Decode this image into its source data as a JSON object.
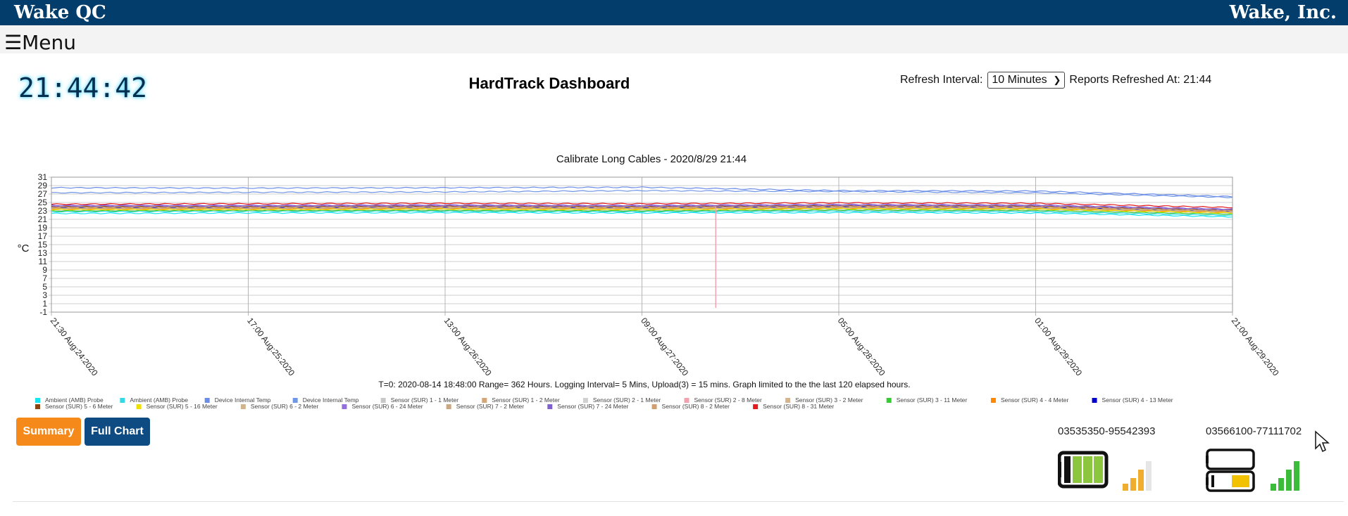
{
  "app": {
    "left_title": "Wake QC",
    "right_title": "Wake, Inc."
  },
  "menu": {
    "icon": "hamburger-icon",
    "label": "☰Menu"
  },
  "clock": "21:44:42",
  "dashboard_title": "HardTrack Dashboard",
  "refresh": {
    "label": "Refresh Interval:",
    "selected": "10 Minutes",
    "reports_text": "Reports Refreshed At: 21:44"
  },
  "chart_data": {
    "type": "line",
    "title": "Calibrate Long Cables - 2020/8/29 21:44",
    "ylabel": "°C",
    "xlabel": "",
    "ylim": [
      -1,
      31
    ],
    "yticks": [
      "31",
      "29",
      "27",
      "25",
      "23",
      "21",
      "19",
      "17",
      "15",
      "13",
      "11",
      "9",
      "7",
      "5",
      "3",
      "1",
      "-1"
    ],
    "x": [
      0,
      20,
      40,
      60,
      80,
      100,
      120
    ],
    "xlim": [
      0,
      120
    ],
    "xticks": [
      {
        "hours": 0,
        "label": "21:30 Aug:24:2020"
      },
      {
        "hours": 20,
        "label": "17:00 Aug:25:2020"
      },
      {
        "hours": 40,
        "label": "13:00 Aug:26:2020"
      },
      {
        "hours": 60,
        "label": "09:00 Aug:27:2020"
      },
      {
        "hours": 80,
        "label": "05:00 Aug:28:2020"
      },
      {
        "hours": 100,
        "label": "01:00 Aug:29:2020"
      },
      {
        "hours": 120,
        "label": "21:00 Aug:29:2020"
      }
    ],
    "footnote": "T=0: 2020-08-14 18:48:00 Range= 362 Hours. Logging Interval= 5 Mins, Upload(3) = 15 mins. Graph limited to the the last 120 elapsed hours.",
    "grid": true,
    "series": [
      {
        "name": "Ambient (AMB) Probe",
        "color": "#19e5f0",
        "values": [
          22.4,
          22.5,
          22.6,
          22.5,
          22.6,
          22.5,
          21.6
        ]
      },
      {
        "name": "Ambient (AMB) Probe",
        "color": "#35d8e6",
        "values": [
          22.8,
          22.9,
          22.9,
          22.8,
          22.9,
          22.8,
          21.9
        ]
      },
      {
        "name": "Device Internal Temp",
        "color": "#6b8de8",
        "values": [
          28.5,
          28.4,
          28.5,
          28.6,
          27.8,
          27.7,
          26.4
        ]
      },
      {
        "name": "Device Internal Temp",
        "color": "#7096e6",
        "values": [
          27.3,
          27.4,
          27.5,
          27.8,
          27.6,
          27.3,
          26.2
        ]
      },
      {
        "name": "Sensor (SUR) 1 - 1 Meter",
        "color": "#c8c8c8",
        "values": [
          23.4,
          23.4,
          23.5,
          23.4,
          23.6,
          23.5,
          22.6
        ]
      },
      {
        "name": "Sensor (SUR) 1 - 2 Meter",
        "color": "#d2a679",
        "values": [
          23.6,
          23.6,
          23.7,
          23.6,
          23.8,
          23.7,
          22.8
        ]
      },
      {
        "name": "Sensor (SUR) 2 - 1 Meter",
        "color": "#d0d0d0",
        "values": [
          23.2,
          23.2,
          23.3,
          23.2,
          23.4,
          23.3,
          22.4
        ]
      },
      {
        "name": "Sensor (SUR) 2 - 8 Meter",
        "color": "#f3a3b0",
        "values": [
          24.1,
          24.1,
          24.2,
          24.0,
          24.2,
          24.1,
          23.1
        ]
      },
      {
        "name": "Sensor (SUR) 3 - 2 Meter",
        "color": "#d8b48a",
        "values": [
          23.8,
          23.8,
          23.9,
          23.8,
          24.0,
          23.9,
          23.0
        ]
      },
      {
        "name": "Sensor (SUR) 3 - 11 Meter",
        "color": "#33cc33",
        "values": [
          23.0,
          23.1,
          23.1,
          23.0,
          23.2,
          23.1,
          22.2
        ]
      },
      {
        "name": "Sensor (SUR) 4 - 4 Meter",
        "color": "#ff8800",
        "values": [
          23.5,
          23.5,
          23.6,
          23.5,
          23.7,
          23.6,
          22.7
        ]
      },
      {
        "name": "Sensor (SUR) 4 - 13 Meter",
        "color": "#0000cc",
        "values": [
          23.9,
          23.9,
          24.0,
          23.9,
          24.1,
          24.0,
          23.0
        ]
      },
      {
        "name": "Sensor (SUR) 5 - 6 Meter",
        "color": "#8b4513",
        "values": [
          24.0,
          24.0,
          24.1,
          24.0,
          24.2,
          24.1,
          23.1
        ]
      },
      {
        "name": "Sensor (SUR) 5 - 16 Meter",
        "color": "#f0e000",
        "values": [
          23.3,
          23.3,
          23.4,
          23.3,
          23.5,
          23.4,
          22.5
        ]
      },
      {
        "name": "Sensor (SUR) 6 - 2 Meter",
        "color": "#d2b48c",
        "values": [
          23.7,
          23.7,
          23.8,
          23.7,
          23.9,
          23.8,
          22.9
        ]
      },
      {
        "name": "Sensor (SUR) 6 - 24 Meter",
        "color": "#9370db",
        "values": [
          24.2,
          24.2,
          24.3,
          24.2,
          24.4,
          24.3,
          23.3
        ]
      },
      {
        "name": "Sensor (SUR) 7 - 2 Meter",
        "color": "#c8a882",
        "values": [
          23.6,
          23.6,
          23.7,
          23.6,
          23.8,
          23.7,
          22.8
        ]
      },
      {
        "name": "Sensor (SUR) 7 - 24 Meter",
        "color": "#8060d0",
        "values": [
          24.3,
          24.3,
          24.4,
          24.3,
          24.5,
          24.4,
          23.4
        ]
      },
      {
        "name": "Sensor (SUR) 8 - 2 Meter",
        "color": "#d0a070",
        "values": [
          23.9,
          23.9,
          24.0,
          23.9,
          24.1,
          24.0,
          23.0
        ]
      },
      {
        "name": "Sensor (SUR) 8 - 31 Meter",
        "color": "#e41a1c",
        "values": [
          24.6,
          24.7,
          24.8,
          24.7,
          24.9,
          24.8,
          23.8
        ]
      }
    ]
  },
  "buttons": {
    "summary": "Summary",
    "full_chart": "Full Chart"
  },
  "devices": [
    {
      "serial": "03535350-95542393",
      "battery_icon": "battery-full-icon",
      "battery_level": 1.0,
      "battery_color": "#8cc63f",
      "signal_icon": "signal-bars-icon",
      "signal_bars": 3,
      "signal_total": 4,
      "signal_color": "#f0ad30"
    },
    {
      "serial": "03566100-77111702",
      "battery_icon": "battery-half-icon",
      "battery_level": 0.5,
      "battery_color": "#f2c200",
      "signal_icon": "signal-bars-icon",
      "signal_bars": 4,
      "signal_total": 4,
      "signal_color": "#3bbd3b"
    }
  ],
  "cursor_icon": "mouse-pointer-icon"
}
